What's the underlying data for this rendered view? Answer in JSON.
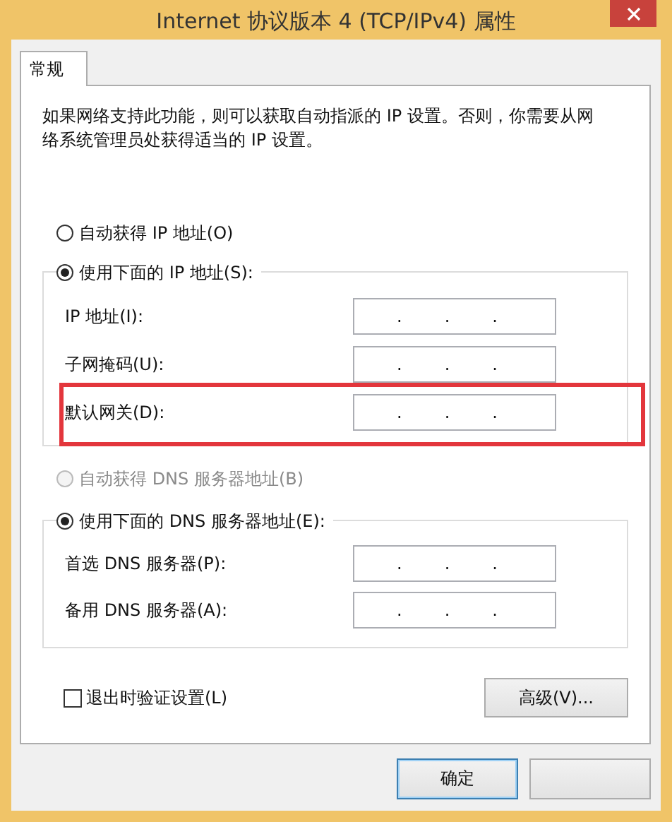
{
  "window": {
    "title": "Internet 协议版本 4 (TCP/IPv4) 属性"
  },
  "tabs": [
    {
      "label": "常规",
      "selected": true
    }
  ],
  "description": "如果网络支持此功能，则可以获取自动指派的 IP 设置。否则，你需要从网络系统管理员处获得适当的 IP 设置。",
  "ip_section": {
    "options": [
      {
        "label": "自动获得 IP 地址(O)",
        "selected": false,
        "disabled": false
      },
      {
        "label": "使用下面的 IP 地址(S):",
        "selected": true,
        "disabled": false
      }
    ],
    "fields": [
      {
        "label": "IP 地址(I):",
        "separators": [
          ".",
          ".",
          "."
        ],
        "highlighted": false
      },
      {
        "label": "子网掩码(U):",
        "separators": [
          ".",
          ".",
          "."
        ],
        "highlighted": false
      },
      {
        "label": "默认网关(D):",
        "separators": [
          ".",
          ".",
          "."
        ],
        "highlighted": true
      }
    ]
  },
  "dns_section": {
    "options": [
      {
        "label": "自动获得 DNS 服务器地址(B)",
        "selected": false,
        "disabled": true
      },
      {
        "label": "使用下面的 DNS 服务器地址(E):",
        "selected": true,
        "disabled": false
      }
    ],
    "fields": [
      {
        "label": "首选 DNS 服务器(P):",
        "separators": [
          ".",
          ".",
          "."
        ],
        "highlighted": false
      },
      {
        "label": "备用 DNS 服务器(A):",
        "separators": [
          ".",
          ".",
          "."
        ],
        "highlighted": false
      }
    ]
  },
  "validate_on_exit": {
    "label": "退出时验证设置(L)",
    "checked": false
  },
  "advanced_button": "高级(V)...",
  "buttons": [
    {
      "kind": "default",
      "label": "确定"
    },
    {
      "kind": "plain"
    }
  ]
}
